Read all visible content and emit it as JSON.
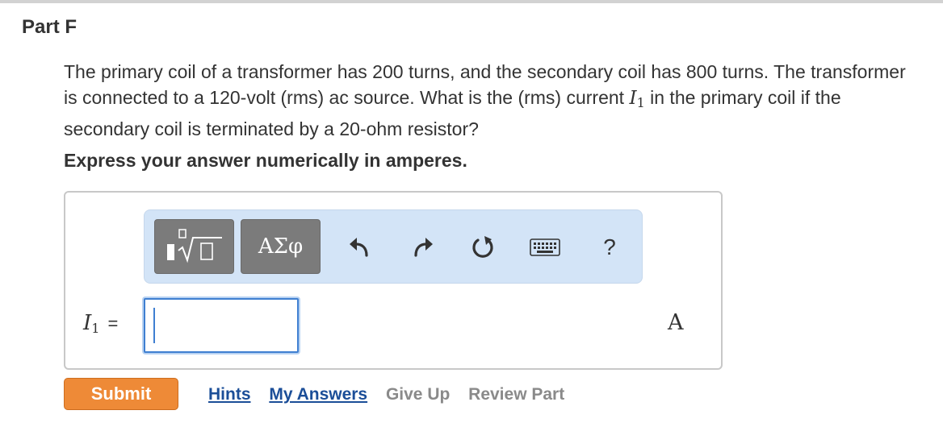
{
  "part": {
    "title": "Part F"
  },
  "question": {
    "text_before": "The primary coil of a transformer has 200 turns, and the secondary coil has 800 turns. The transformer is connected to a 120-volt (rms) ac source. What is the (rms) current ",
    "var_symbol": "I",
    "var_subscript": "1",
    "text_after": " in the primary coil if the secondary coil is terminated by a 20-ohm resistor?"
  },
  "instruction": "Express your answer numerically in amperes.",
  "toolbar": {
    "templates_icon": "templates-radical-icon",
    "greek_label": "ΑΣφ",
    "undo_icon": "undo-icon",
    "redo_icon": "redo-icon",
    "reset_icon": "reset-icon",
    "keyboard_icon": "keyboard-icon",
    "help_label": "?"
  },
  "answer": {
    "var_symbol": "I",
    "var_subscript": "1",
    "equals": "=",
    "value": "",
    "unit": "A"
  },
  "actions": {
    "submit_label": "Submit",
    "hints_label": "Hints",
    "my_answers_label": "My Answers",
    "give_up_label": "Give Up",
    "review_part_label": "Review Part"
  },
  "colors": {
    "submit_bg": "#ee8a37",
    "toolbar_bg": "#d3e4f7",
    "link_active": "#1b4e98",
    "link_muted": "#8a8a8a",
    "input_border": "#3f7fd1"
  }
}
